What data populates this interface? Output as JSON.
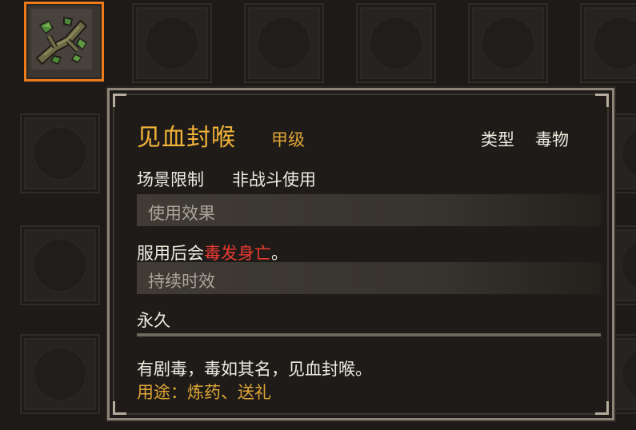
{
  "item": {
    "name": "见血封喉",
    "grade": "甲级",
    "type_label": "类型",
    "type_value": "毒物",
    "scene_label": "场景限制",
    "scene_value": "非战斗使用",
    "icon": "poison-herb-icon"
  },
  "effect": {
    "header": "使用效果",
    "text_before": "服用后会",
    "text_highlight": "毒发身亡",
    "text_after": "。"
  },
  "duration": {
    "header": "持续时效",
    "value": "永久"
  },
  "description": "有剧毒，毒如其名，见血封喉。",
  "usage": "用途：炼药、送礼",
  "colors": {
    "title": "#f1b23a",
    "highlight": "#ea3b32",
    "selected_border": "#ef7a1a",
    "usage": "#e0a537"
  }
}
